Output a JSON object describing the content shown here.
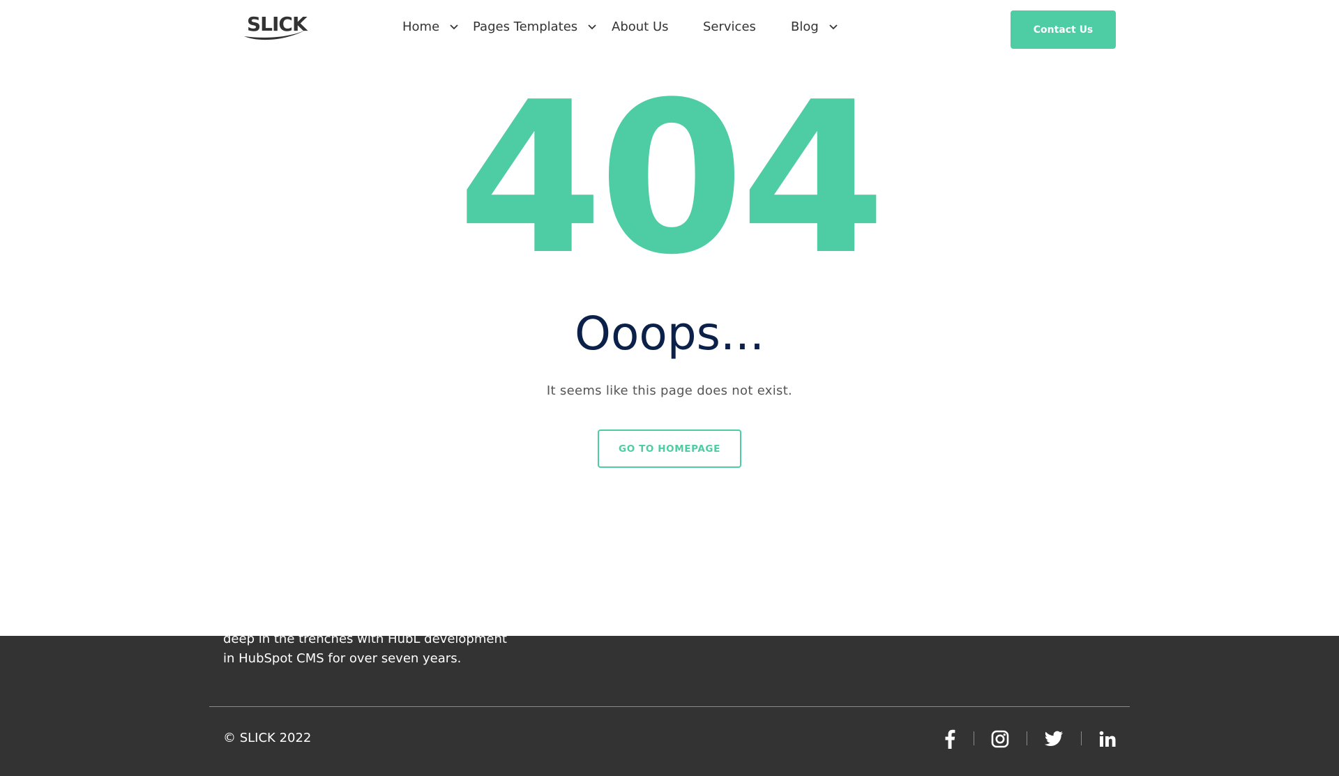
{
  "header": {
    "logo_text": "SLICK",
    "nav": [
      {
        "label": "Home",
        "has_dropdown": true
      },
      {
        "label": "Pages Templates",
        "has_dropdown": true
      },
      {
        "label": "About Us",
        "has_dropdown": false
      },
      {
        "label": "Services",
        "has_dropdown": false
      },
      {
        "label": "Blog",
        "has_dropdown": true
      }
    ],
    "contact_label": "Contact Us"
  },
  "main": {
    "error_code": "404",
    "heading": "Ooops...",
    "message": "It seems like this page does not exist.",
    "home_button_label": "GO TO HOMEPAGE"
  },
  "footer": {
    "text_line_1": "deep in the trenches with HubL development",
    "text_line_2": "in HubSpot CMS  for over seven years.",
    "copyright": "© SLICK 2022",
    "social": [
      {
        "icon": "facebook-icon"
      },
      {
        "icon": "instagram-icon"
      },
      {
        "icon": "twitter-icon"
      },
      {
        "icon": "linkedin-icon"
      }
    ]
  },
  "colors": {
    "accent": "#4ecca3",
    "heading": "#0c2149",
    "footer_bg": "#333333"
  }
}
